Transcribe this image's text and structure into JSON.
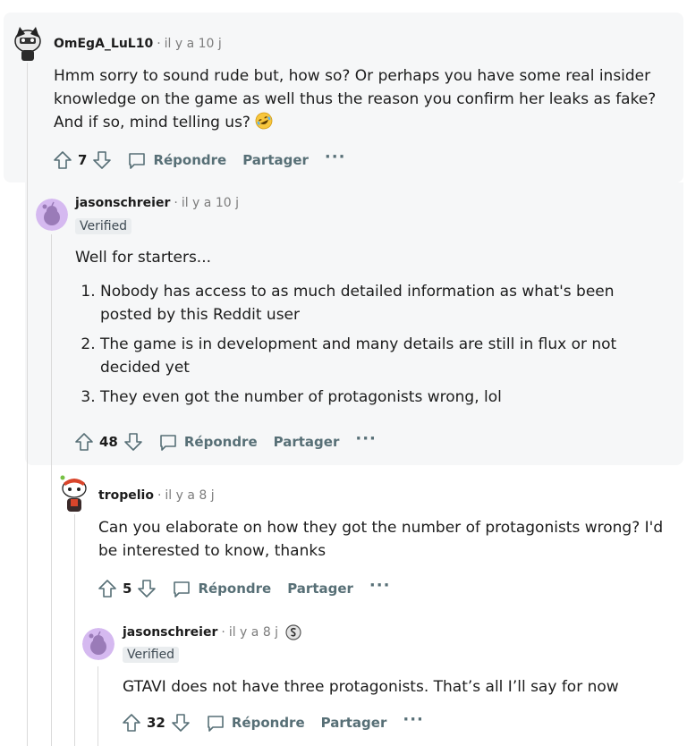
{
  "comments": [
    {
      "author": "OmEgA_LuL10",
      "separator": "·",
      "time": "il y a 10 j",
      "text": "Hmm sorry to sound rude but, how so? Or perhaps you have some real insider knowledge on the game as well thus the reason you confirm her leaks as fake? And if so, mind telling us?",
      "emoji": "rofl-emoji",
      "votes": "7",
      "reply": "Répondre",
      "share": "Partager",
      "more": "···"
    },
    {
      "author": "jasonschreier",
      "separator": "·",
      "time": "il y a 10 j",
      "badge": "Verified",
      "intro": "Well for starters...",
      "list": [
        "Nobody has access to as much detailed information as what's been posted by this Reddit user",
        "The game is in development and many details are still in flux or not decided yet",
        "They even got the number of protagonists wrong, lol"
      ],
      "votes": "48",
      "reply": "Répondre",
      "share": "Partager",
      "more": "···"
    },
    {
      "author": "tropelio",
      "separator": "·",
      "time": "il y a 8 j",
      "text": "Can you elaborate on how they got the number of protagonists wrong? I'd be interested to know, thanks",
      "votes": "5",
      "reply": "Répondre",
      "share": "Partager",
      "more": "···"
    },
    {
      "author": "jasonschreier",
      "separator": "·",
      "time": "il y a 8 j",
      "award": "silver-award-icon",
      "badge": "Verified",
      "text": "GTAVI does not have three protagonists. That’s all I’ll say for now",
      "votes": "32",
      "reply": "Répondre",
      "share": "Partager",
      "more": "···"
    }
  ],
  "colors": {
    "highlight_bg": "#f6f7f8",
    "meta_gray": "#7c7c7c",
    "action_gray": "#576f76",
    "thread_line": "#dadada",
    "avatar_purple": "#c4a5e8"
  }
}
